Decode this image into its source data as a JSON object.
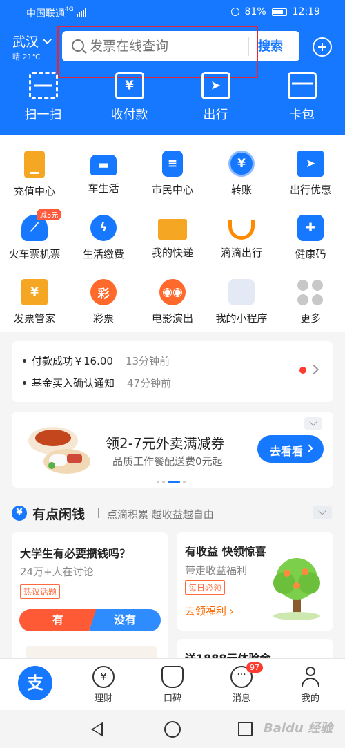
{
  "status_bar": {
    "carrier": "中国联通",
    "network": "4G",
    "battery": "81%",
    "time": "12:19"
  },
  "header": {
    "city": "武汉",
    "weather": "晴 21℃",
    "search_placeholder": "发票在线查询",
    "search_button": "搜索"
  },
  "top_actions": [
    {
      "label": "扫一扫",
      "icon": "scan-icon"
    },
    {
      "label": "收付款",
      "icon": "pay-receive-icon"
    },
    {
      "label": "出行",
      "icon": "travel-icon"
    },
    {
      "label": "卡包",
      "icon": "card-wallet-icon"
    }
  ],
  "grid": [
    {
      "label": "充值中心",
      "icon": "phone-recharge-icon",
      "color": "#f5a623"
    },
    {
      "label": "车生活",
      "icon": "car-icon",
      "color": "#1677ff"
    },
    {
      "label": "市民中心",
      "icon": "citizen-icon",
      "color": "#1677ff"
    },
    {
      "label": "转账",
      "icon": "transfer-icon",
      "color": "#1677ff"
    },
    {
      "label": "出行优惠",
      "icon": "gift-icon",
      "color": "#1677ff"
    },
    {
      "label": "火车票机票",
      "icon": "train-icon",
      "color": "#1677ff",
      "badge": "减5元"
    },
    {
      "label": "生活缴费",
      "icon": "utility-icon",
      "color": "#1677ff"
    },
    {
      "label": "我的快递",
      "icon": "delivery-truck-icon",
      "color": "#f5a623"
    },
    {
      "label": "滴滴出行",
      "icon": "didi-icon",
      "color": "#ff8a00"
    },
    {
      "label": "健康码",
      "icon": "health-code-icon",
      "color": "#1677ff"
    },
    {
      "label": "发票管家",
      "icon": "invoice-icon",
      "color": "#f5a623"
    },
    {
      "label": "彩票",
      "icon": "lottery-icon",
      "color": "#ff6a2c",
      "glyph": "彩"
    },
    {
      "label": "电影演出",
      "icon": "movie-icon",
      "color": "#ff6a2c"
    },
    {
      "label": "我的小程序",
      "icon": "mini-program-icon",
      "color": "#e3e9f5"
    },
    {
      "label": "更多",
      "icon": "more-icon",
      "color": "#cfcfcf"
    }
  ],
  "notifications": [
    {
      "text": "付款成功￥16.00",
      "time": "13分钟前"
    },
    {
      "text": "基金买入确认通知",
      "time": "47分钟前"
    }
  ],
  "promo": {
    "title": "领2-7元外卖满减券",
    "subtitle": "品质工作餐配送费0元起",
    "button": "去看看"
  },
  "section": {
    "title": "有点闲钱",
    "subtitle": "点滴积累 越收益越自由"
  },
  "card_left": {
    "question": "大学生有必要攒钱吗？",
    "count": "24万+人在讨论",
    "tag": "热议话题",
    "yes": "有",
    "no": "没有"
  },
  "card_right": {
    "title": "有收益 快领惊喜",
    "subtitle": "带走收益福利",
    "tag": "每日必领",
    "link": "去领福利"
  },
  "card_right2": {
    "title": "送1888元体验金"
  },
  "tabbar": [
    {
      "label": "",
      "icon": "alipay-home-icon"
    },
    {
      "label": "理财",
      "icon": "wealth-icon"
    },
    {
      "label": "口碑",
      "icon": "koubei-icon"
    },
    {
      "label": "消息",
      "icon": "message-icon",
      "badge": "97"
    },
    {
      "label": "我的",
      "icon": "profile-icon"
    }
  ],
  "watermark": "Baidu 经验"
}
